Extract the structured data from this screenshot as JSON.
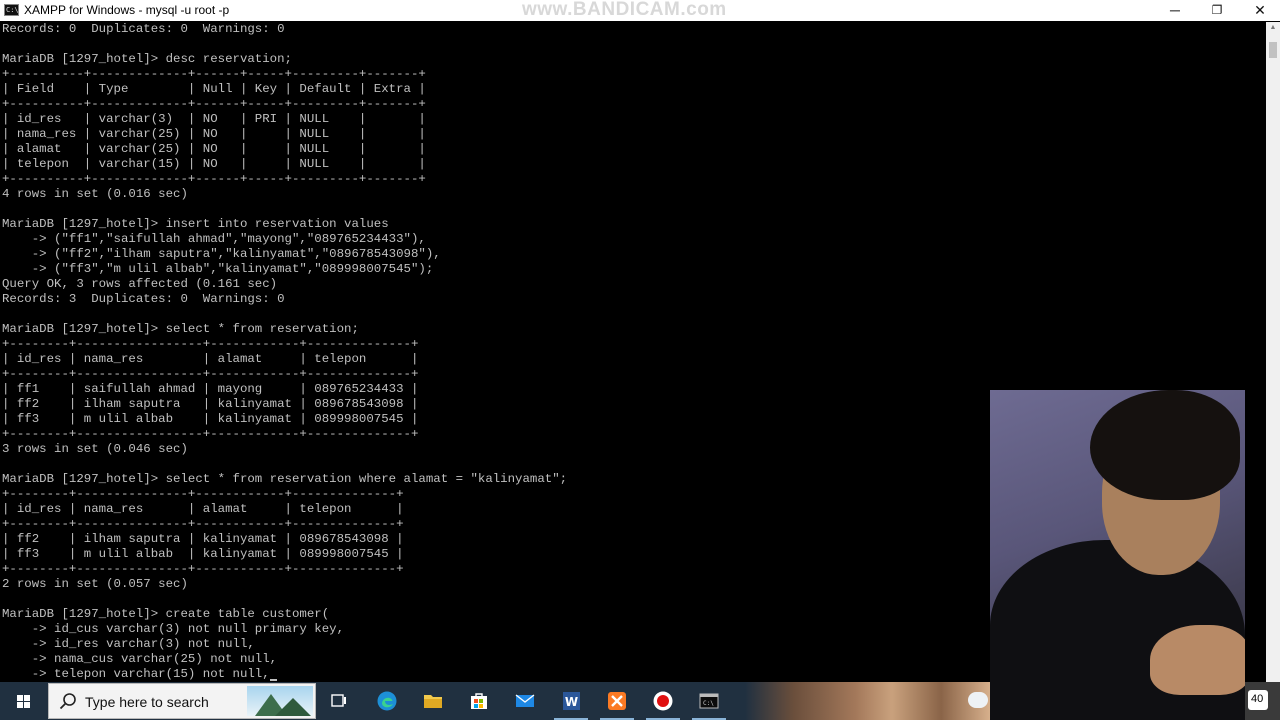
{
  "window": {
    "title": "XAMPP for Windows - mysql  -u root -p",
    "watermark": "www.BANDICAM.com",
    "minimize_glyph": "─",
    "maximize_glyph": "❐",
    "close_glyph": "✕"
  },
  "console": {
    "lines": [
      "Records: 0  Duplicates: 0  Warnings: 0",
      "",
      "MariaDB [1297_hotel]> desc reservation;",
      "+----------+-------------+------+-----+---------+-------+",
      "| Field    | Type        | Null | Key | Default | Extra |",
      "+----------+-------------+------+-----+---------+-------+",
      "| id_res   | varchar(3)  | NO   | PRI | NULL    |       |",
      "| nama_res | varchar(25) | NO   |     | NULL    |       |",
      "| alamat   | varchar(25) | NO   |     | NULL    |       |",
      "| telepon  | varchar(15) | NO   |     | NULL    |       |",
      "+----------+-------------+------+-----+---------+-------+",
      "4 rows in set (0.016 sec)",
      "",
      "MariaDB [1297_hotel]> insert into reservation values",
      "    -> (\"ff1\",\"saifullah ahmad\",\"mayong\",\"089765234433\"),",
      "    -> (\"ff2\",\"ilham saputra\",\"kalinyamat\",\"089678543098\"),",
      "    -> (\"ff3\",\"m ulil albab\",\"kalinyamat\",\"089998007545\");",
      "Query OK, 3 rows affected (0.161 sec)",
      "Records: 3  Duplicates: 0  Warnings: 0",
      "",
      "MariaDB [1297_hotel]> select * from reservation;",
      "+--------+-----------------+------------+--------------+",
      "| id_res | nama_res        | alamat     | telepon      |",
      "+--------+-----------------+------------+--------------+",
      "| ff1    | saifullah ahmad | mayong     | 089765234433 |",
      "| ff2    | ilham saputra   | kalinyamat | 089678543098 |",
      "| ff3    | m ulil albab    | kalinyamat | 089998007545 |",
      "+--------+-----------------+------------+--------------+",
      "3 rows in set (0.046 sec)",
      "",
      "MariaDB [1297_hotel]> select * from reservation where alamat = \"kalinyamat\";",
      "+--------+---------------+------------+--------------+",
      "| id_res | nama_res      | alamat     | telepon      |",
      "+--------+---------------+------------+--------------+",
      "| ff2    | ilham saputra | kalinyamat | 089678543098 |",
      "| ff3    | m ulil albab  | kalinyamat | 089998007545 |",
      "+--------+---------------+------------+--------------+",
      "2 rows in set (0.057 sec)",
      "",
      "MariaDB [1297_hotel]> create table customer(",
      "    -> id_cus varchar(3) not null primary key,",
      "    -> id_res varchar(3) not null,",
      "    -> nama_cus varchar(25) not null,",
      "    -> telepon varchar(15) not null,"
    ]
  },
  "taskbar": {
    "search_placeholder": "Type here to search",
    "apps": [
      "task-view-icon",
      "edge-icon",
      "file-explorer-icon",
      "store-icon",
      "mail-icon",
      "word-icon",
      "xampp-icon",
      "bandicam-record-icon",
      "terminal-icon"
    ],
    "notification_count": "40"
  },
  "colors": {
    "console_bg": "#000000",
    "console_text": "#c0c0c0",
    "taskbar_bg": "#203040",
    "titlebar_bg": "#ffffff"
  }
}
